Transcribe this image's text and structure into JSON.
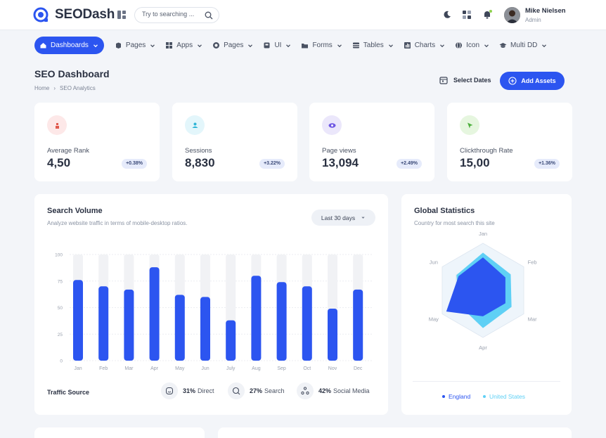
{
  "app": {
    "name": "SEODash"
  },
  "search": {
    "placeholder": "Try to searching ..."
  },
  "user": {
    "name": "Mike Nielsen",
    "role": "Admin"
  },
  "nav": [
    {
      "label": "Dashboards",
      "icon": "home-icon",
      "active": true
    },
    {
      "label": "Pages",
      "icon": "pages-icon"
    },
    {
      "label": "Apps",
      "icon": "apps-icon"
    },
    {
      "label": "Pages",
      "icon": "layers-icon"
    },
    {
      "label": "UI",
      "icon": "ui-icon"
    },
    {
      "label": "Forms",
      "icon": "folder-icon"
    },
    {
      "label": "Tables",
      "icon": "table-icon"
    },
    {
      "label": "Charts",
      "icon": "chart-icon"
    },
    {
      "label": "Icon",
      "icon": "globe-icon"
    },
    {
      "label": "Multi DD",
      "icon": "cap-icon"
    }
  ],
  "page": {
    "title": "SEO Dashboard",
    "breadcrumb": [
      "Home",
      "SEO Analytics"
    ],
    "select_dates": "Select Dates",
    "add_assets": "Add Assets"
  },
  "stats": [
    {
      "label": "Average Rank",
      "value": "4,50",
      "change": "+0.38%",
      "icon": "rank-icon",
      "bg": "#fde8e8",
      "fg": "#e05a4e"
    },
    {
      "label": "Sessions",
      "value": "8,830",
      "change": "+3.22%",
      "icon": "users-icon",
      "bg": "#e3f6fb",
      "fg": "#2fb5d6"
    },
    {
      "label": "Page views",
      "value": "13,094",
      "change": "+2.49%",
      "icon": "eye-icon",
      "bg": "#ebe7fb",
      "fg": "#6f58e3"
    },
    {
      "label": "Clickthrough Rate",
      "value": "15,00",
      "change": "+1.36%",
      "icon": "cursor-icon",
      "bg": "#e6f6df",
      "fg": "#4caf3c"
    }
  ],
  "search_volume": {
    "title": "Search Volume",
    "subtitle": "Analyze website traffic in terms of mobile-desktop ratios.",
    "range": "Last 30 days",
    "traffic_label": "Traffic Source",
    "sources": [
      {
        "pct": "31%",
        "name": "Direct",
        "icon": "smile-icon"
      },
      {
        "pct": "27%",
        "name": "Search",
        "icon": "search-icon"
      },
      {
        "pct": "42%",
        "name": "Social Media",
        "icon": "share-icon"
      }
    ]
  },
  "chart_data": [
    {
      "type": "bar",
      "categories": [
        "Jan",
        "Feb",
        "Mar",
        "Apr",
        "May",
        "Jun",
        "July",
        "Aug",
        "Sep",
        "Oct",
        "Nov",
        "Dec"
      ],
      "values": [
        76,
        70,
        67,
        88,
        62,
        60,
        38,
        80,
        74,
        70,
        49,
        67
      ],
      "yticks": [
        0,
        25,
        50,
        75,
        100
      ],
      "ylim": [
        0,
        100
      ],
      "color": "#2c55f0",
      "track_color": "#f1f2f5"
    },
    {
      "type": "radar",
      "title": "Global Statistics",
      "subtitle": "Country for most search this site",
      "axes": [
        "Jan",
        "Feb",
        "Mar",
        "Apr",
        "May",
        "Jun"
      ],
      "ylim": [
        0,
        100
      ],
      "series": [
        {
          "name": "England",
          "color": "#2c55f0",
          "values": [
            70,
            55,
            55,
            55,
            90,
            60
          ]
        },
        {
          "name": "United States",
          "color": "#5fd0f5",
          "values": [
            80,
            68,
            70,
            80,
            60,
            65
          ]
        }
      ]
    }
  ]
}
